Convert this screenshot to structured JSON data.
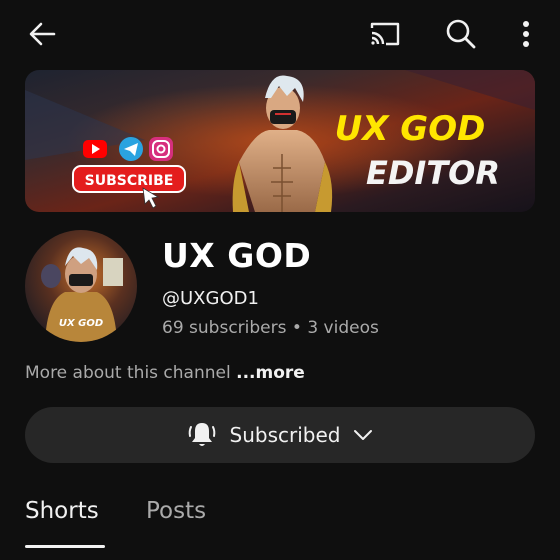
{
  "channel": {
    "name": "UX GOD",
    "handle": "@UXGOD1",
    "subscribers": "69 subscribers",
    "separator": "•",
    "videos": "3 videos",
    "avatar_text": "UX GOD"
  },
  "banner": {
    "title_line1": "UX GOD",
    "title_line2": "EDITOR",
    "subscribe_label": "SUBSCRIBE",
    "social_icons": [
      "youtube-icon",
      "telegram-icon",
      "instagram-icon"
    ]
  },
  "about": {
    "text": "More about this channel",
    "more": "...more"
  },
  "subscribe_button": {
    "label": "Subscribed"
  },
  "tabs": [
    {
      "label": "Shorts",
      "active": true
    },
    {
      "label": "Posts",
      "active": false
    }
  ],
  "topbar": {
    "icons": [
      "back-arrow-icon",
      "cast-icon",
      "search-icon",
      "more-vert-icon"
    ]
  },
  "colors": {
    "background": "#0f0f0f",
    "button_bg": "#272727",
    "secondary_text": "#aaaaaa",
    "banner_title": "#ffe600",
    "youtube_red": "#ff0000"
  }
}
